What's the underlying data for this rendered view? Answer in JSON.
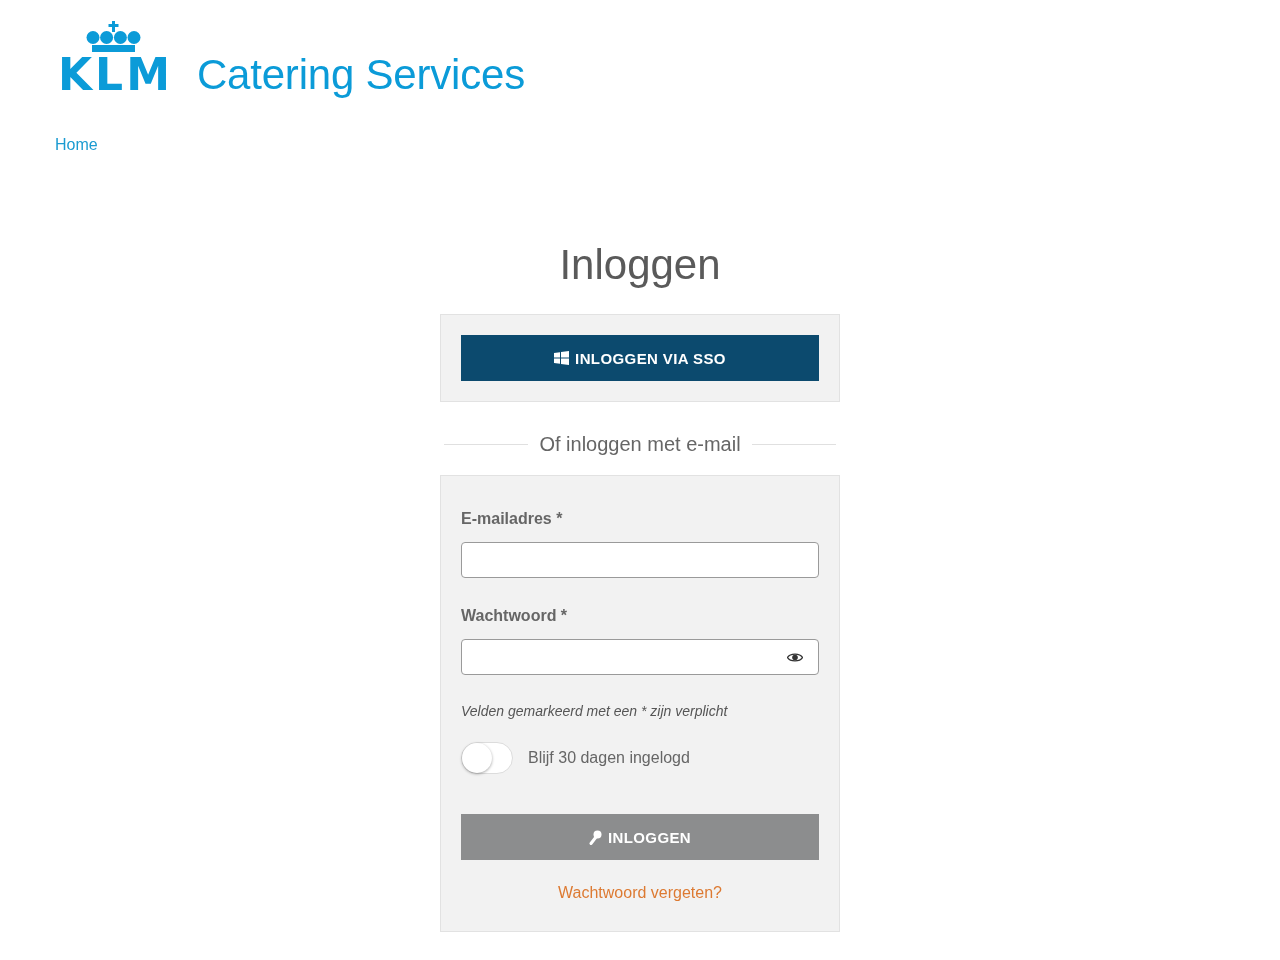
{
  "header": {
    "logo": {
      "wordmark": "KLM",
      "name": "Catering Services"
    },
    "breadcrumb": [
      {
        "label": "Home"
      }
    ]
  },
  "login": {
    "title": "Inloggen",
    "sso_button": {
      "label": "INLOGGEN VIA SSO"
    },
    "divider": "Of inloggen met e-mail",
    "fields": [
      {
        "kind": "email",
        "label": "E-mailadres *"
      },
      {
        "kind": "password",
        "label": "Wachtwoord *"
      }
    ],
    "note": "Velden gemarkeerd met een * zijn verplicht",
    "remember": {
      "label": "Blijf 30 dagen ingelogd",
      "on": false
    },
    "submit": {
      "label": "INLOGGEN",
      "disabled": true
    },
    "forgot_link": "Wachtwoord vergeten?"
  }
}
